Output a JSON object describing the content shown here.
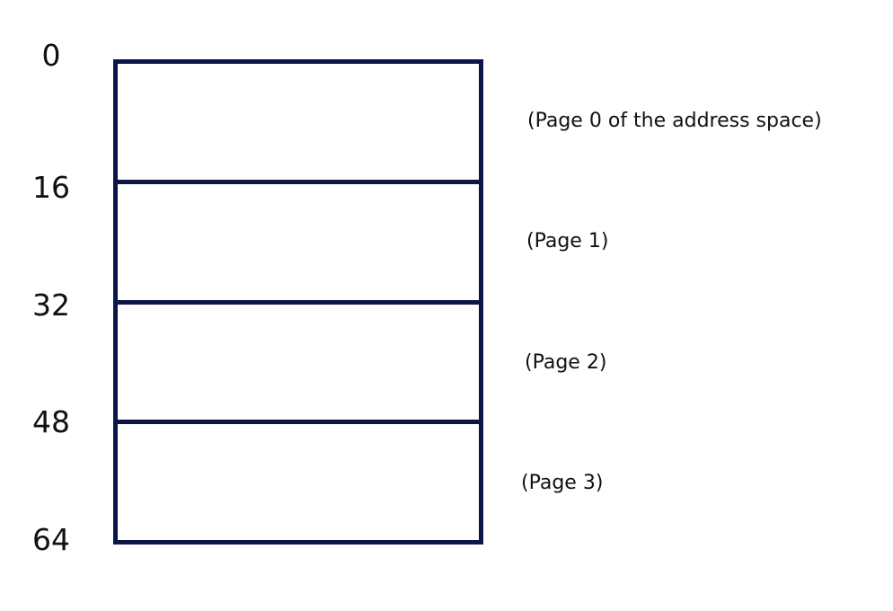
{
  "address_labels": [
    "0",
    "16",
    "32",
    "48",
    "64"
  ],
  "pages": [
    {
      "label": "(Page 0 of the address space)"
    },
    {
      "label": "(Page 1)"
    },
    {
      "label": "(Page 2)"
    },
    {
      "label": "(Page 3)"
    }
  ],
  "colors": {
    "block_border": "#0b1547",
    "text": "#111111",
    "background": "#ffffff"
  }
}
